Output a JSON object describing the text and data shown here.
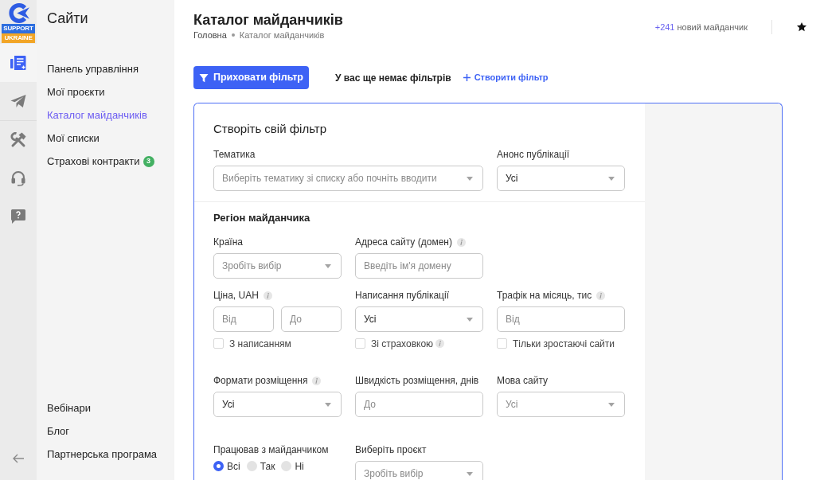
{
  "logo": {
    "tagline": [
      "SUPPORT",
      "UKRAINE"
    ]
  },
  "rail": {
    "groups": [
      [
        {
          "kind": "catalog",
          "selected": true
        },
        {
          "kind": "send",
          "selected": false
        }
      ],
      [
        {
          "kind": "tools",
          "selected": false
        },
        {
          "kind": "support",
          "selected": false
        },
        {
          "kind": "help",
          "selected": false
        }
      ]
    ]
  },
  "sidebar": {
    "title": "Сайти",
    "items": [
      {
        "label": "Панель управління",
        "selected": false
      },
      {
        "label": "Мої проєкти",
        "selected": false
      },
      {
        "label": "Каталог майданчиків",
        "selected": true
      },
      {
        "label": "Мої списки",
        "selected": false
      },
      {
        "label": "Страхові контракти",
        "selected": false,
        "badge": "3"
      }
    ],
    "footer_items": [
      {
        "label": "Вебінари",
        "selected": false
      },
      {
        "label": "Блог",
        "selected": false
      },
      {
        "label": "Партнерська програма",
        "selected": false
      }
    ]
  },
  "header": {
    "title": "Каталог майданчиків",
    "breadcrumb": [
      "Головна",
      "Каталог майданчиків"
    ],
    "new_count": "+241",
    "new_label": "новий майданчик"
  },
  "toolbar": {
    "hide_filter_button": "Приховати фільтр",
    "empty_text": "У вас ще немає фільтрів",
    "create_filter_link": "Створити фільтр"
  },
  "filter": {
    "title": "Створіть свій фільтр",
    "main_fields": [
      {
        "kind": "select",
        "label": "Тематика",
        "placeholder": "Виберіть тематику зі списку або почніть вводити"
      },
      {
        "kind": "select",
        "label": "Анонс публікації",
        "value": "Усі"
      }
    ],
    "region": {
      "title": "Регіон майданчика",
      "rows": [
        [
          {
            "kind": "select",
            "label": "Країна",
            "placeholder": "Зробіть вибір"
          },
          {
            "kind": "input",
            "label": "Адреса сайту (домен)",
            "info": true,
            "placeholder": "Введіть ім'я домену"
          }
        ],
        [
          {
            "kind": "range",
            "label": "Ціна, UAH",
            "info": true,
            "from_placeholder": "Від",
            "to_placeholder": "До",
            "checkbox": {
              "label": "З написанням",
              "checked": false
            }
          },
          {
            "kind": "select",
            "label": "Написання публікації",
            "value": "Усі",
            "checkbox": {
              "label": "Зі страховкою",
              "checked": false,
              "info": true
            }
          },
          {
            "kind": "input",
            "label": "Трафік на місяць, тис",
            "info": true,
            "placeholder": "Від",
            "checkbox": {
              "label": "Тільки зростаючі сайти",
              "checked": false
            }
          }
        ],
        [
          {
            "kind": "select",
            "label": "Формати розміщення",
            "info": true,
            "value": "Усі"
          },
          {
            "kind": "input",
            "label": "Швидкість розміщення, днів",
            "placeholder": "До"
          },
          {
            "kind": "select",
            "label": "Мова сайту",
            "placeholder": "Усі"
          }
        ],
        [
          {
            "kind": "radio",
            "label": "Працював з майданчиком",
            "options": [
              {
                "label": "Всі",
                "selected": true
              },
              {
                "label": "Так",
                "selected": false
              },
              {
                "label": "Ні",
                "selected": false
              }
            ]
          },
          {
            "kind": "select",
            "label": "Виберіть проєкт",
            "placeholder": "Зробіть вибір"
          }
        ]
      ]
    }
  }
}
